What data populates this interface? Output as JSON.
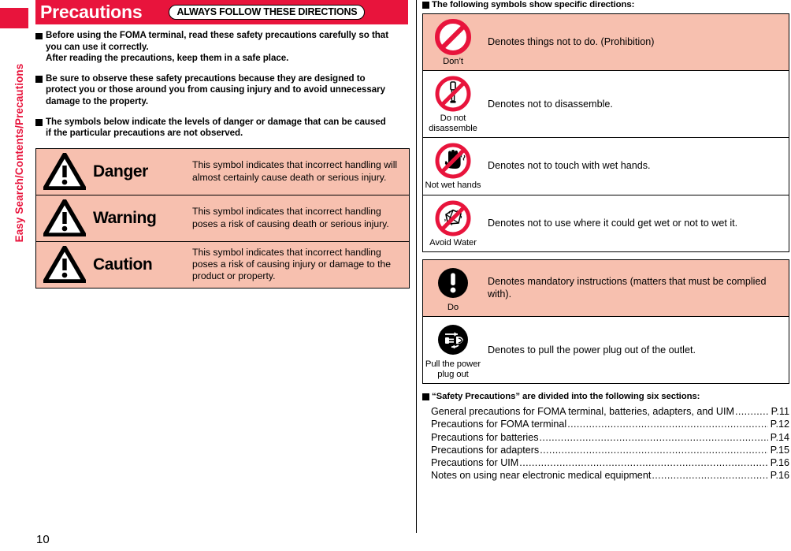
{
  "sidebar": {
    "vertical_label": "Easy Search/Contents/Precautions"
  },
  "page_number": "10",
  "header": {
    "title": "Precautions",
    "pill_label": "ALWAYS FOLLOW THESE DIRECTIONS"
  },
  "intro_bullets": [
    {
      "lines": [
        "Before using the FOMA terminal, read these safety precautions carefully so that",
        "you can use it correctly.",
        "After reading the precautions, keep them in a safe place."
      ]
    },
    {
      "lines": [
        "Be sure to observe these safety precautions because they are designed to",
        "protect you or those around you from causing injury and to avoid unnecessary",
        "damage to the property."
      ]
    },
    {
      "lines": [
        "The symbols below indicate the levels of danger or damage that can be caused",
        "if the particular precautions are not observed."
      ]
    }
  ],
  "danger_levels": [
    {
      "icon": "warning-triangle-icon",
      "name": "Danger",
      "description": "This symbol indicates that incorrect handling will almost certainly cause death or serious injury."
    },
    {
      "icon": "warning-triangle-icon",
      "name": "Warning",
      "description": "This symbol indicates that incorrect handling poses a risk of causing death or serious injury."
    },
    {
      "icon": "warning-triangle-icon",
      "name": "Caution",
      "description": "This symbol indicates that incorrect handling poses a risk of causing injury or damage to the product or property."
    }
  ],
  "right": {
    "symbols_heading": "The following symbols show specific directions:",
    "prohibition_symbols": [
      {
        "icon": "prohibition-slash-icon",
        "caption": "Don’t",
        "description": "Denotes things not to do. (Prohibition)",
        "highlighted": true
      },
      {
        "icon": "no-disassemble-screwdriver-icon",
        "caption": "Do not disassemble",
        "description": "Denotes not to disassemble.",
        "highlighted": false
      },
      {
        "icon": "no-wet-hands-icon",
        "caption": "Not wet hands",
        "description": "Denotes not to touch with wet hands.",
        "highlighted": false
      },
      {
        "icon": "avoid-water-icon",
        "caption": "Avoid Water",
        "description": "Denotes not to use where it could get wet or not to wet it.",
        "highlighted": false
      }
    ],
    "mandatory_symbols": [
      {
        "icon": "mandatory-exclamation-icon",
        "caption": "Do",
        "description": "Denotes mandatory instructions (matters that must be complied with).",
        "highlighted": true
      },
      {
        "icon": "unplug-power-plug-icon",
        "caption": "Pull the power plug out",
        "description": "Denotes to pull the power plug out of the outlet.",
        "highlighted": false
      }
    ],
    "toc_heading": "“Safety Precautions” are divided into the following six sections:",
    "toc_entries": [
      {
        "label": "General precautions for FOMA terminal, batteries, adapters, and UIM",
        "page": "P.11"
      },
      {
        "label": "Precautions for FOMA terminal ",
        "page": "P.12"
      },
      {
        "label": "Precautions for batteries ",
        "page": "P.14"
      },
      {
        "label": "Precautions for adapters",
        "page": "P.15"
      },
      {
        "label": "Precautions for UIM",
        "page": "P.16"
      },
      {
        "label": "Notes on using near electronic medical equipment ",
        "page": "P.16"
      }
    ]
  },
  "colors": {
    "brand_red": "#e8143c",
    "panel_pink": "#f7c0af",
    "ink": "#000000"
  }
}
